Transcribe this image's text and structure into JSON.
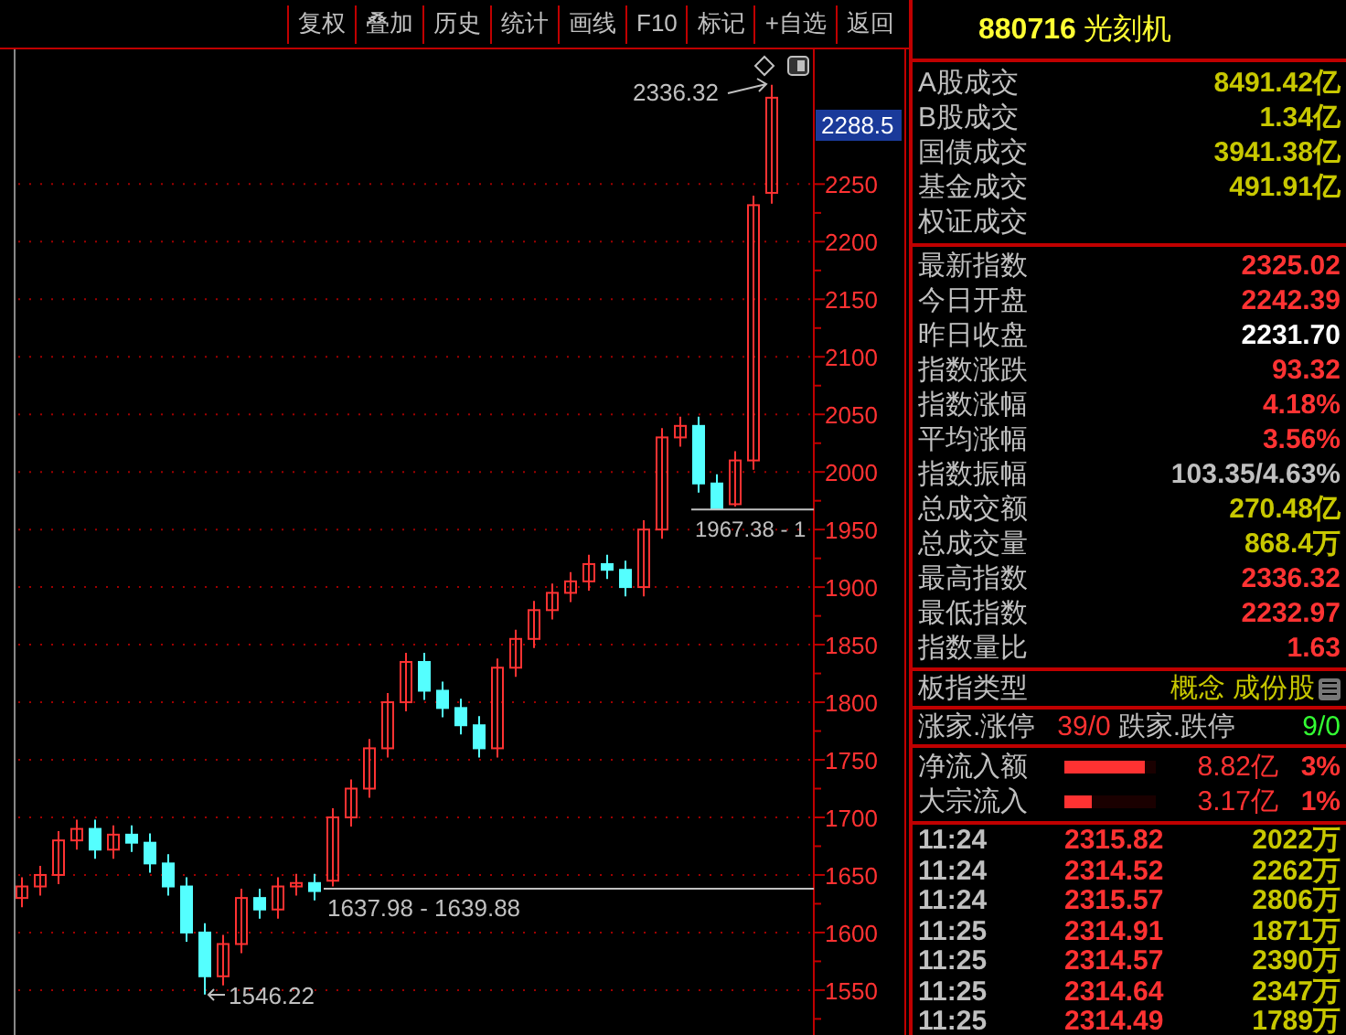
{
  "toolbar": [
    {
      "label": "复权"
    },
    {
      "label": "叠加"
    },
    {
      "label": "历史"
    },
    {
      "label": "统计"
    },
    {
      "label": "画线"
    },
    {
      "label": "F10"
    },
    {
      "label": "标记"
    },
    {
      "label": "+自选"
    },
    {
      "label": "返回"
    }
  ],
  "chart": {
    "price_labels": [
      "2250",
      "2200",
      "2150",
      "2100",
      "2050",
      "2000",
      "1950",
      "1900",
      "1850",
      "1800",
      "1750",
      "1700",
      "1650",
      "1600",
      "1550"
    ],
    "current_price": "2288.5",
    "annotations": [
      {
        "kind": "high",
        "text": "2336.32"
      },
      {
        "kind": "range",
        "text": "1967.38 - 1"
      },
      {
        "kind": "range",
        "text": "1637.98 - 1639.88"
      },
      {
        "kind": "low",
        "text": "1546.22"
      }
    ],
    "chart_data": {
      "type": "candlestick",
      "grid": true,
      "ylim": [
        1511,
        2367
      ],
      "yticks": [
        1550,
        1600,
        1650,
        1700,
        1750,
        1800,
        1850,
        1900,
        1950,
        2000,
        2050,
        2100,
        2150,
        2200,
        2250
      ],
      "ohlc": [
        [
          1630,
          1648,
          1622,
          1640
        ],
        [
          1640,
          1658,
          1632,
          1650
        ],
        [
          1650,
          1688,
          1642,
          1680
        ],
        [
          1680,
          1698,
          1672,
          1690
        ],
        [
          1690,
          1698,
          1664,
          1672
        ],
        [
          1672,
          1693,
          1664,
          1685
        ],
        [
          1685,
          1693,
          1670,
          1678
        ],
        [
          1678,
          1686,
          1652,
          1660
        ],
        [
          1660,
          1668,
          1632,
          1640
        ],
        [
          1640,
          1648,
          1592,
          1600
        ],
        [
          1600,
          1608,
          1546.22,
          1562
        ],
        [
          1562,
          1598,
          1554,
          1590
        ],
        [
          1590,
          1638,
          1582,
          1630
        ],
        [
          1630,
          1638,
          1612,
          1620
        ],
        [
          1620,
          1648,
          1612,
          1640
        ],
        [
          1640,
          1651,
          1632,
          1643
        ],
        [
          1643,
          1651,
          1628,
          1636
        ],
        [
          1645,
          1708,
          1640,
          1700
        ],
        [
          1700,
          1733,
          1692,
          1725
        ],
        [
          1725,
          1768,
          1717,
          1760
        ],
        [
          1760,
          1808,
          1752,
          1800
        ],
        [
          1800,
          1843,
          1792,
          1835
        ],
        [
          1835,
          1843,
          1802,
          1810
        ],
        [
          1810,
          1818,
          1787,
          1795
        ],
        [
          1795,
          1803,
          1772,
          1780
        ],
        [
          1780,
          1788,
          1752,
          1760
        ],
        [
          1760,
          1838,
          1752,
          1830
        ],
        [
          1830,
          1863,
          1822,
          1855
        ],
        [
          1855,
          1888,
          1847,
          1880
        ],
        [
          1880,
          1903,
          1872,
          1895
        ],
        [
          1895,
          1913,
          1887,
          1905
        ],
        [
          1905,
          1928,
          1897,
          1920
        ],
        [
          1920,
          1928,
          1907,
          1915
        ],
        [
          1915,
          1923,
          1892,
          1900
        ],
        [
          1900,
          1958,
          1892,
          1950
        ],
        [
          1950,
          2038,
          1942,
          2030
        ],
        [
          2030,
          2048,
          2022,
          2040
        ],
        [
          2040,
          2048,
          1982,
          1990
        ],
        [
          1990,
          1998,
          1968,
          1968
        ],
        [
          1972,
          2018,
          1970,
          2010
        ],
        [
          2010,
          2240,
          2002,
          2231.7
        ],
        [
          2242.39,
          2336.32,
          2232.97,
          2325.02
        ]
      ]
    }
  },
  "quote": {
    "code": "880716",
    "name": "光刻机",
    "volume_rows": [
      {
        "label": "A股成交",
        "value": "8491.42亿"
      },
      {
        "label": "B股成交",
        "value": "1.34亿"
      },
      {
        "label": "国债成交",
        "value": "3941.38亿"
      },
      {
        "label": "基金成交",
        "value": "491.91亿"
      },
      {
        "label": "权证成交"
      }
    ],
    "index_rows": [
      {
        "label": "最新指数",
        "value": "2325.02",
        "color": "#ff3333"
      },
      {
        "label": "今日开盘",
        "value": "2242.39",
        "color": "#ff3333"
      },
      {
        "label": "昨日收盘",
        "value": "2231.70",
        "color": "#ffffff"
      },
      {
        "label": "指数涨跌",
        "value": "93.32",
        "color": "#ff3333"
      },
      {
        "label": "指数涨幅",
        "value": "4.18%",
        "color": "#ff3333"
      },
      {
        "label": "平均涨幅",
        "value": "3.56%",
        "color": "#ff3333"
      },
      {
        "label": "指数振幅",
        "value": "103.35/4.63%",
        "color": "#c0c0c0"
      },
      {
        "label": "总成交额",
        "value": "270.48亿",
        "color": "#c8c800"
      },
      {
        "label": "总成交量",
        "value": "868.4万",
        "color": "#c8c800"
      },
      {
        "label": "最高指数",
        "value": "2336.32",
        "color": "#ff3333"
      },
      {
        "label": "最低指数",
        "value": "2232.97",
        "color": "#ff3333"
      },
      {
        "label": "指数量比",
        "value": "1.63",
        "color": "#ff3333"
      }
    ],
    "type_row": {
      "label": "板指类型",
      "value": "概念 成份股"
    },
    "breadth": {
      "up_label": "涨家.涨停",
      "up_value": "39/0",
      "down_label": "跌家.跌停",
      "down_value": "9/0"
    },
    "flows": [
      {
        "label": "净流入额",
        "level": 0.88,
        "value": "8.82亿",
        "pct": "3%"
      },
      {
        "label": "大宗流入",
        "level": 0.3,
        "value": "3.17亿",
        "pct": "1%"
      }
    ],
    "trades": [
      {
        "time": "11:24",
        "price": "2315.82",
        "volume": "2022万"
      },
      {
        "time": "11:24",
        "price": "2314.52",
        "volume": "2262万"
      },
      {
        "time": "11:24",
        "price": "2315.57",
        "volume": "2806万"
      },
      {
        "time": "11:25",
        "price": "2314.91",
        "volume": "1871万"
      },
      {
        "time": "11:25",
        "price": "2314.57",
        "volume": "2390万"
      },
      {
        "time": "11:25",
        "price": "2314.64",
        "volume": "2347万"
      },
      {
        "time": "11:25",
        "price": "2314.49",
        "volume": "1789万"
      }
    ]
  }
}
